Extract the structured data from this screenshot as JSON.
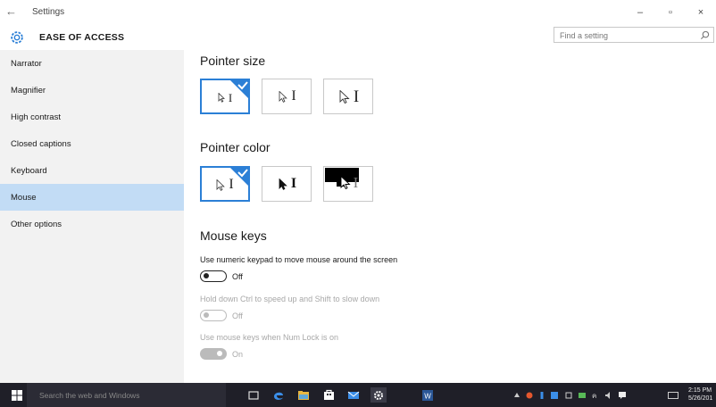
{
  "window": {
    "title": "Settings",
    "controls": {
      "minimize": "–",
      "maximize": "▫",
      "close": "×"
    },
    "back_icon": "back-arrow-icon"
  },
  "header": {
    "heading": "EASE OF ACCESS",
    "icon": "gear-icon",
    "search_placeholder": "Find a setting"
  },
  "sidebar": {
    "items": [
      {
        "label": "Narrator",
        "active": false
      },
      {
        "label": "Magnifier",
        "active": false
      },
      {
        "label": "High contrast",
        "active": false
      },
      {
        "label": "Closed captions",
        "active": false
      },
      {
        "label": "Keyboard",
        "active": false
      },
      {
        "label": "Mouse",
        "active": true
      },
      {
        "label": "Other options",
        "active": false
      }
    ]
  },
  "pointer_size": {
    "title": "Pointer size",
    "selected_index": 0,
    "options": [
      "small",
      "medium",
      "large"
    ]
  },
  "pointer_color": {
    "title": "Pointer color",
    "selected_index": 0,
    "options": [
      "white",
      "black",
      "inverted"
    ]
  },
  "mouse_keys": {
    "title": "Mouse keys",
    "settings": [
      {
        "label": "Use numeric keypad to move mouse around the screen",
        "state": "Off",
        "enabled": true
      },
      {
        "label": "Hold down Ctrl to speed up and Shift to slow down",
        "state": "Off",
        "enabled": false
      },
      {
        "label": "Use mouse keys when Num Lock is on",
        "state": "On",
        "enabled": false
      }
    ]
  },
  "colors": {
    "accent": "#2b7fd6",
    "sidebar_bg": "#f2f2f2",
    "sidebar_active": "#c2dcf5",
    "taskbar": "#1f1f28"
  },
  "taskbar": {
    "search_placeholder": "Search the web and Windows",
    "clock_time": "2:15 PM",
    "clock_date": "5/26/201"
  }
}
